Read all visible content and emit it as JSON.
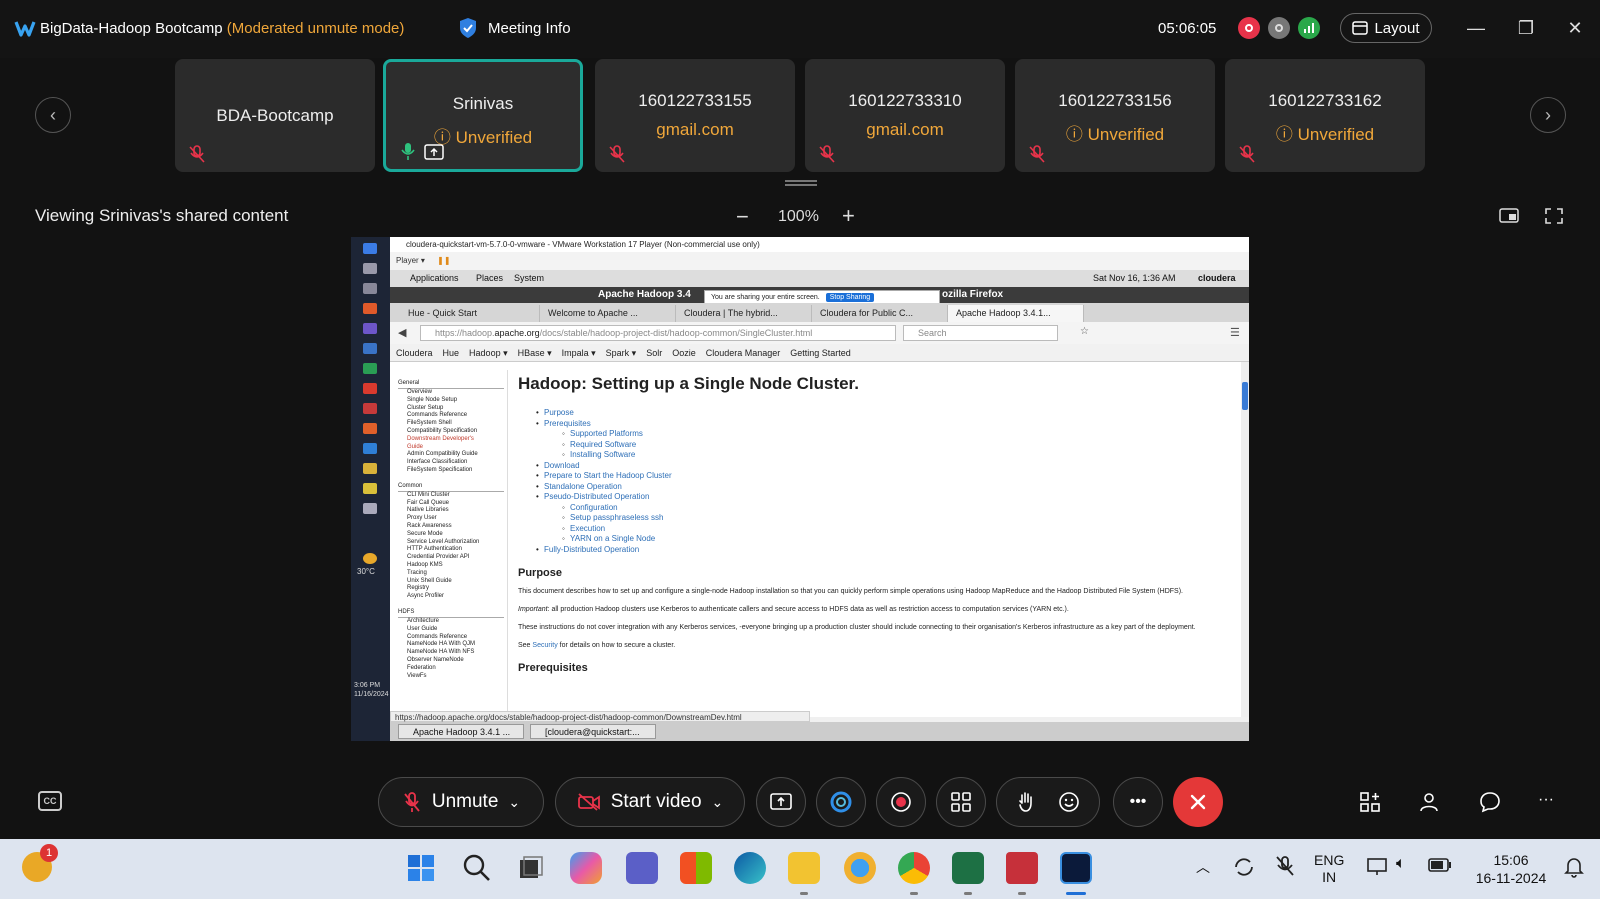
{
  "titlebar": {
    "app_title": "BigData-Hadoop Bootcamp",
    "mode": "(Moderated unmute mode)",
    "meeting_info": "Meeting Info",
    "clock": "05:06:05",
    "layout_label": "Layout"
  },
  "participants": [
    {
      "name": "BDA-Bootcamp",
      "sub": "",
      "active": false
    },
    {
      "name": "Srinivas",
      "sub": "Unverified",
      "active": true
    },
    {
      "name": "160122733155",
      "sub": "gmail.com",
      "active": false
    },
    {
      "name": "160122733310",
      "sub": "gmail.com",
      "active": false
    },
    {
      "name": "160122733156",
      "sub": "Unverified",
      "active": false
    },
    {
      "name": "160122733162",
      "sub": "Unverified",
      "active": false
    }
  ],
  "share": {
    "viewing_text": "Viewing Srinivas's shared content",
    "zoom_minus": "−",
    "zoom": "100%",
    "zoom_plus": "+"
  },
  "vm": {
    "window_title": "cloudera-quickstart-vm-5.7.0-0-vmware - VMware Workstation 17 Player (Non-commercial use only)",
    "player_menu": "Player ▾",
    "gnome": {
      "applications": "Applications",
      "places": "Places",
      "system": "System",
      "datetime": "Sat Nov 16,  1:36 AM",
      "user": "cloudera"
    },
    "side_weather": "30°C",
    "side_time": "3:06 PM",
    "side_date": "11/16/2024",
    "firefox_title": "Apache Hadoop 3.4",
    "firefox_title_right": "ozilla Firefox",
    "share_banner": "You are sharing your entire screen.",
    "stop_sharing": "Stop Sharing",
    "tabs": [
      "Hue - Quick Start",
      "Welcome to Apache ...",
      "Cloudera | The hybrid...",
      "Cloudera for Public C...",
      "Apache Hadoop 3.4.1..."
    ],
    "url_prefix": "https://hadoop.",
    "url_domain": "apache.org",
    "url_path": "/docs/stable/hadoop-project-dist/hadoop-common/SingleCluster.html",
    "search_placeholder": "Search",
    "bookmarks": [
      "Cloudera",
      "Hue",
      "Hadoop ▾",
      "HBase ▾",
      "Impala ▾",
      "Spark ▾",
      "Solr",
      "Oozie",
      "Cloudera Manager",
      "Getting Started"
    ],
    "sidebar": {
      "general_title": "General",
      "general": [
        "Overview",
        "Single Node Setup",
        "Cluster Setup",
        "Commands Reference",
        "FileSystem Shell",
        "Compatibility Specification"
      ],
      "general_red": [
        "Downstream Developer's",
        "Guide"
      ],
      "general_rest": [
        "Admin Compatibility Guide",
        "Interface Classification",
        "FileSystem Specification"
      ],
      "common_title": "Common",
      "common": [
        "CLI Mini Cluster",
        "Fair Call Queue",
        "Native Libraries",
        "Proxy User",
        "Rack Awareness",
        "Secure Mode",
        "Service Level Authorization",
        "HTTP Authentication",
        "Credential Provider API",
        "Hadoop KMS",
        "Tracing",
        "Unix Shell Guide",
        "Registry",
        "Async Profiler"
      ],
      "hdfs_title": "HDFS",
      "hdfs": [
        "Architecture",
        "User Guide",
        "Commands Reference",
        "NameNode HA With QJM",
        "NameNode HA With NFS",
        "Observer NameNode",
        "Federation",
        "ViewFs"
      ]
    },
    "page": {
      "h1": "Hadoop: Setting up a Single Node Cluster.",
      "toc": [
        {
          "level": 1,
          "text": "Purpose"
        },
        {
          "level": 1,
          "text": "Prerequisites"
        },
        {
          "level": 2,
          "text": "Supported Platforms"
        },
        {
          "level": 2,
          "text": "Required Software"
        },
        {
          "level": 2,
          "text": "Installing Software"
        },
        {
          "level": 1,
          "text": "Download"
        },
        {
          "level": 1,
          "text": "Prepare to Start the Hadoop Cluster"
        },
        {
          "level": 1,
          "text": "Standalone Operation"
        },
        {
          "level": 1,
          "text": "Pseudo-Distributed Operation"
        },
        {
          "level": 2,
          "text": "Configuration"
        },
        {
          "level": 2,
          "text": "Setup passphraseless ssh"
        },
        {
          "level": 2,
          "text": "Execution"
        },
        {
          "level": 2,
          "text": "YARN on a Single Node"
        },
        {
          "level": 1,
          "text": "Fully-Distributed Operation"
        }
      ],
      "h2_purpose": "Purpose",
      "p1": "This document describes how to set up and configure a single-node Hadoop installation so that you can quickly perform simple operations using Hadoop MapReduce and the Hadoop Distributed File System (HDFS).",
      "p2_em": "Important",
      "p2": ": all production Hadoop clusters use Kerberos to authenticate callers and secure access to HDFS data as well as restriction access to computation services (YARN etc.).",
      "p3": "These instructions do not cover integration with any Kerberos services, -everyone bringing up a production cluster should include connecting to their organisation's Kerberos infrastructure as a key part of the deployment.",
      "p4_a": "See ",
      "p4_link": "Security",
      "p4_b": " for details on how to secure a cluster.",
      "h2_prereq": "Prerequisites"
    },
    "status_url": "https://hadoop.apache.org/docs/stable/hadoop-project-dist/hadoop-common/DownstreamDev.html",
    "taskbar": [
      "Apache Hadoop 3.4.1 ...",
      "[cloudera@quickstart:..."
    ]
  },
  "controls": {
    "unmute": "Unmute",
    "start_video": "Start video"
  },
  "windows": {
    "notification_count": "1",
    "lang_top": "ENG",
    "lang_bottom": "IN",
    "time": "15:06",
    "date": "16-11-2024"
  },
  "colors": {
    "accent_teal": "#1aa99a",
    "warning_orange": "#f0a73a",
    "end_red": "#e43838",
    "link_blue": "#2e6fb7"
  }
}
